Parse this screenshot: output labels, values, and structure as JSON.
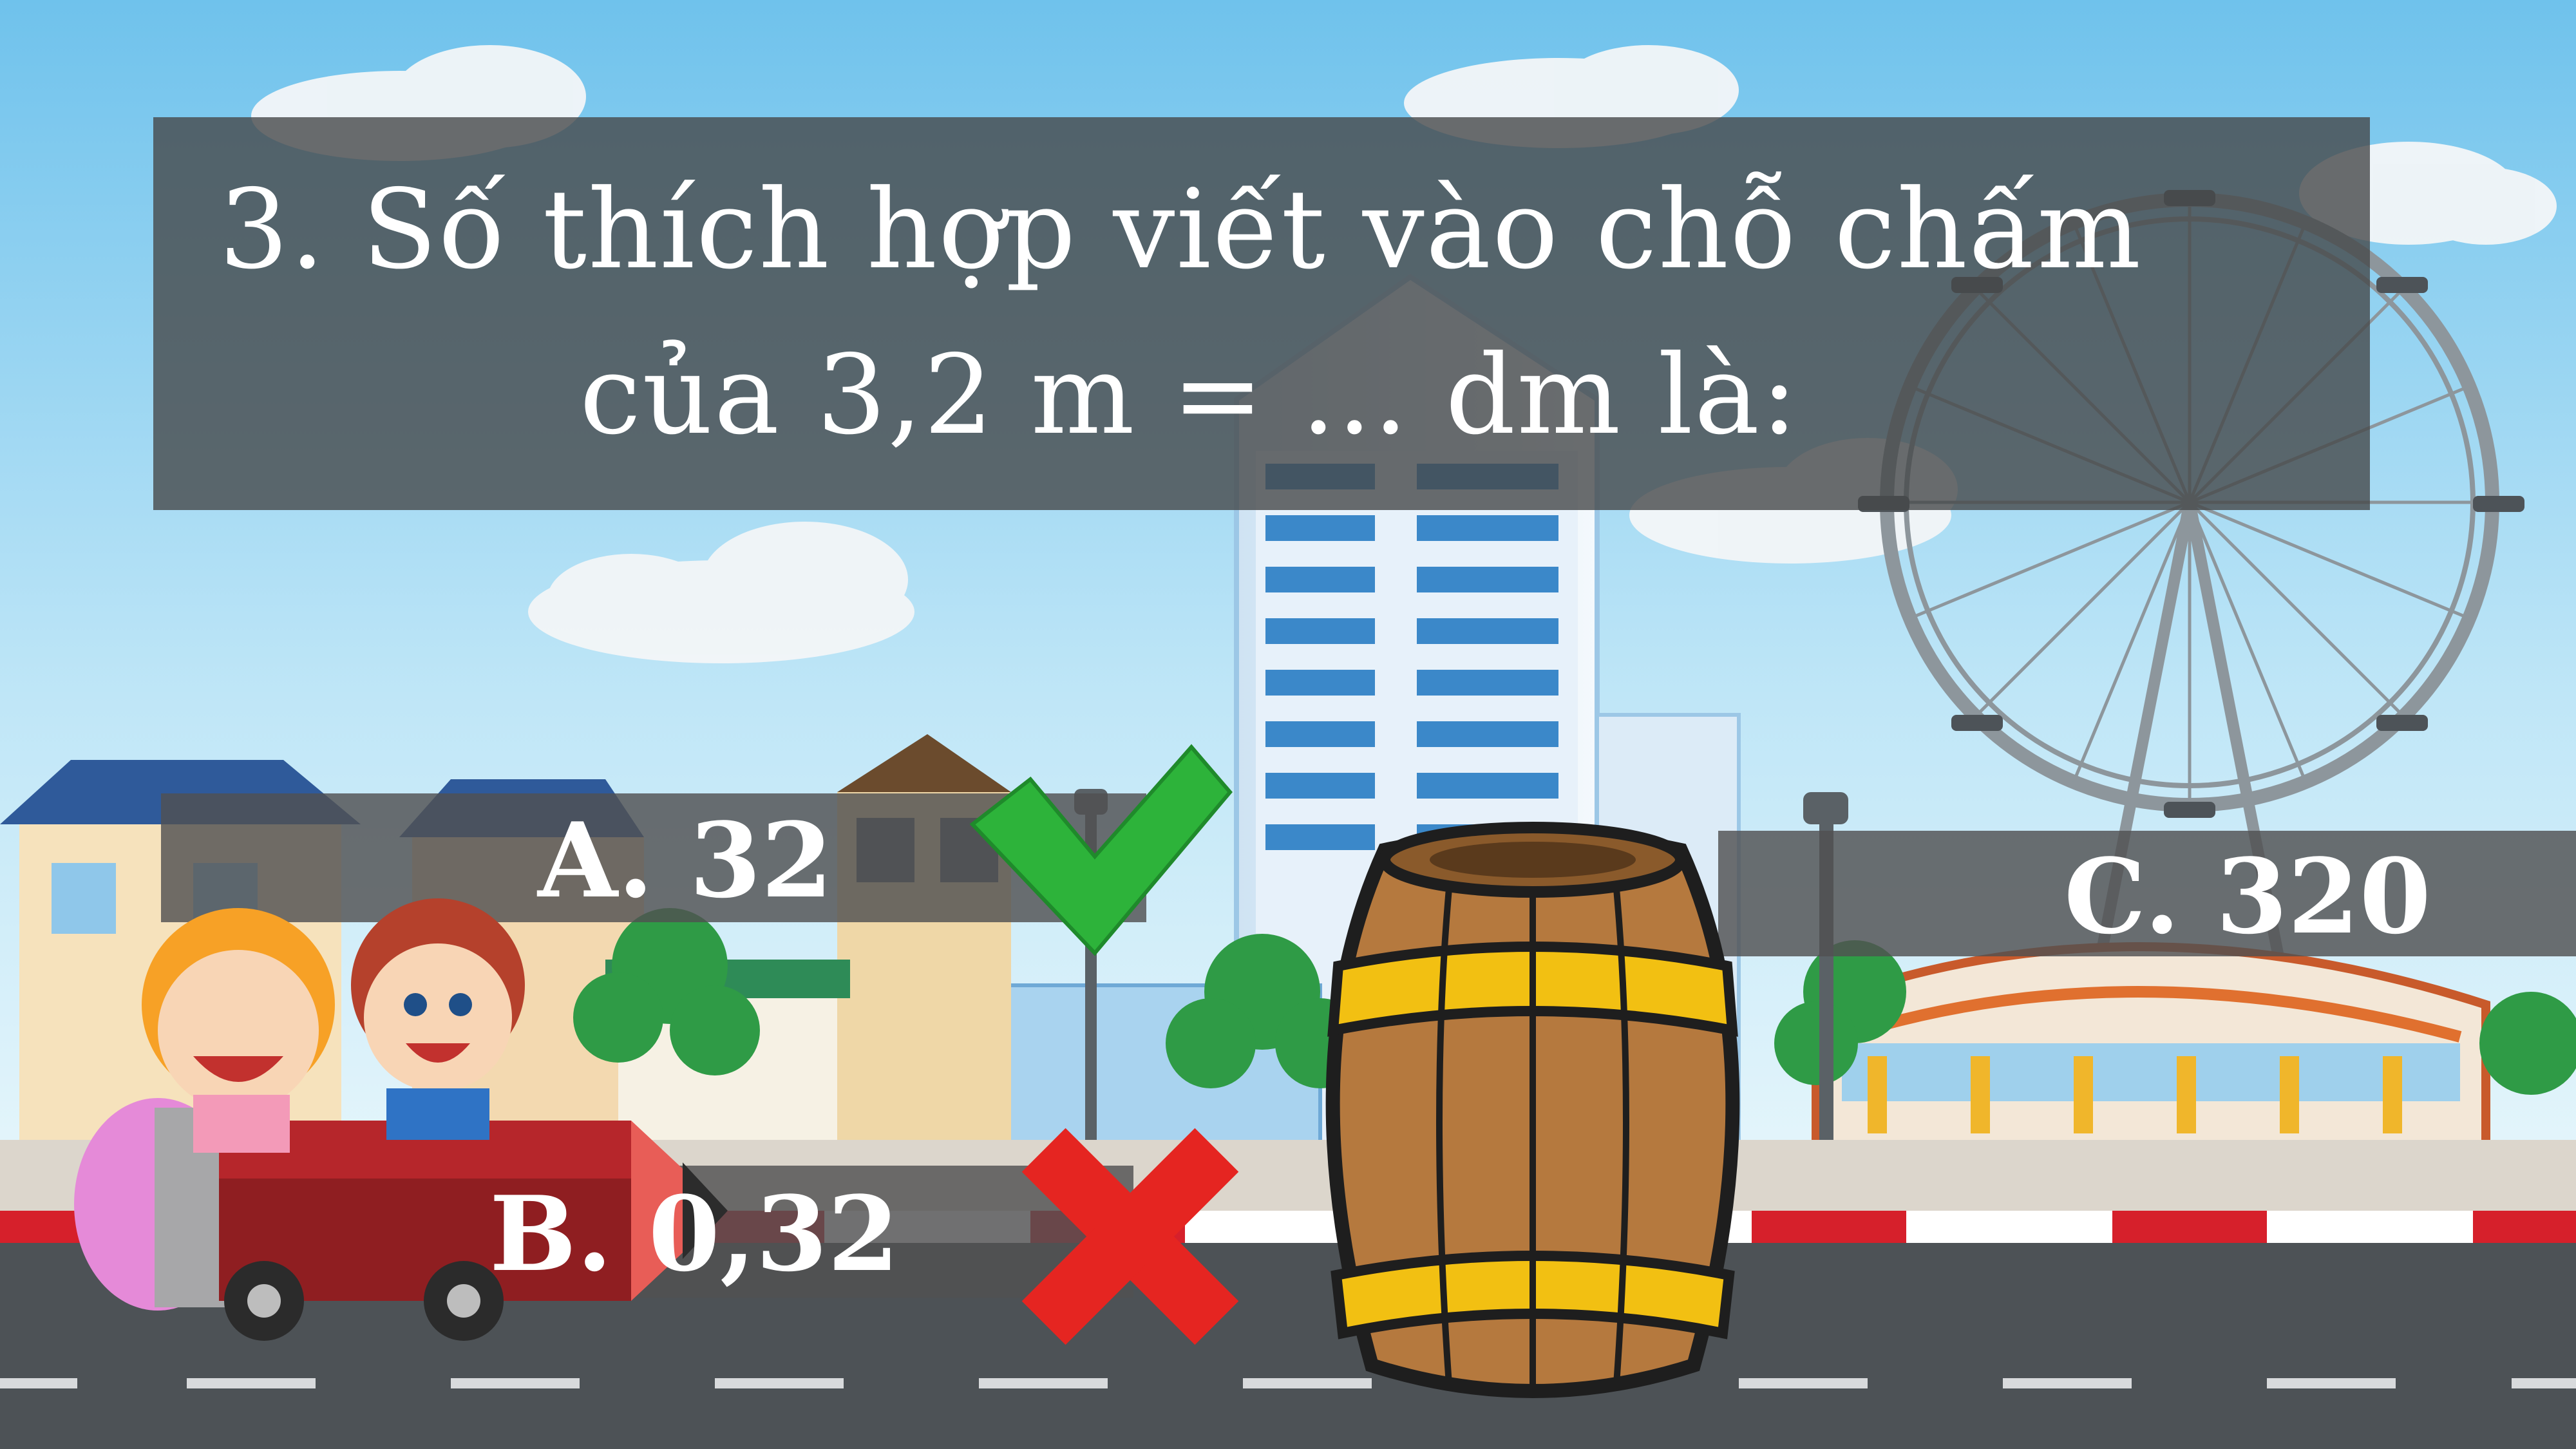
{
  "question": {
    "line1": "3. Số thích hợp viết vào chỗ chấm",
    "line2": "của 3,2 m = ... dm là:"
  },
  "answers": {
    "a": "A. 32",
    "b": "B. 0,32",
    "c": "C. 320"
  },
  "colors": {
    "sky": "#9fd6f2",
    "road": "#4d5256",
    "check": "#2db33a",
    "cross": "#e52521",
    "barrel_wood": "#b5793e",
    "barrel_band": "#f2c012"
  }
}
